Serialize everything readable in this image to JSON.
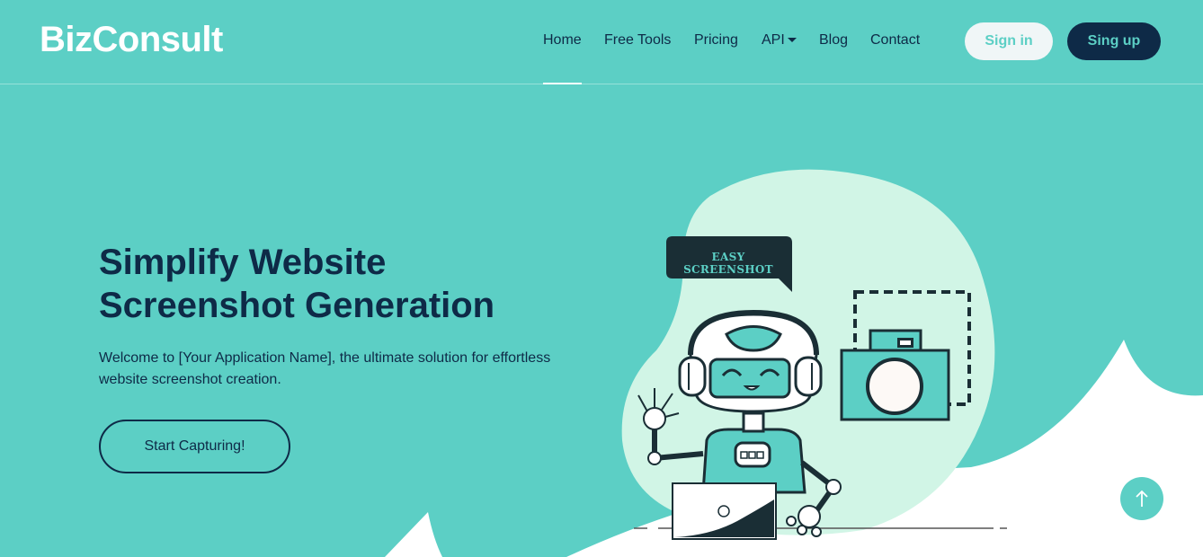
{
  "brand": {
    "logo": "BizConsult"
  },
  "nav": {
    "items": [
      {
        "label": "Home",
        "active": true
      },
      {
        "label": "Free Tools"
      },
      {
        "label": "Pricing"
      },
      {
        "label": "API",
        "dropdown": true
      },
      {
        "label": "Blog"
      },
      {
        "label": "Contact"
      }
    ],
    "signin": "Sign in",
    "signup": "Sing up"
  },
  "hero": {
    "title_line1": "Simplify Website",
    "title_line2": "Screenshot Generation",
    "description": "Welcome to [Your Application Name], the ultimate solution for effortless website screenshot creation.",
    "cta": "Start Capturing!",
    "bubble_text": "EASY SCREENSHOT"
  },
  "icons": {
    "scroll_top": "arrow-up-icon",
    "dropdown": "caret-down-icon"
  },
  "colors": {
    "background": "#5ccfc5",
    "navy": "#0e2a47",
    "blob": "#d1f5e6",
    "white": "#ffffff"
  }
}
